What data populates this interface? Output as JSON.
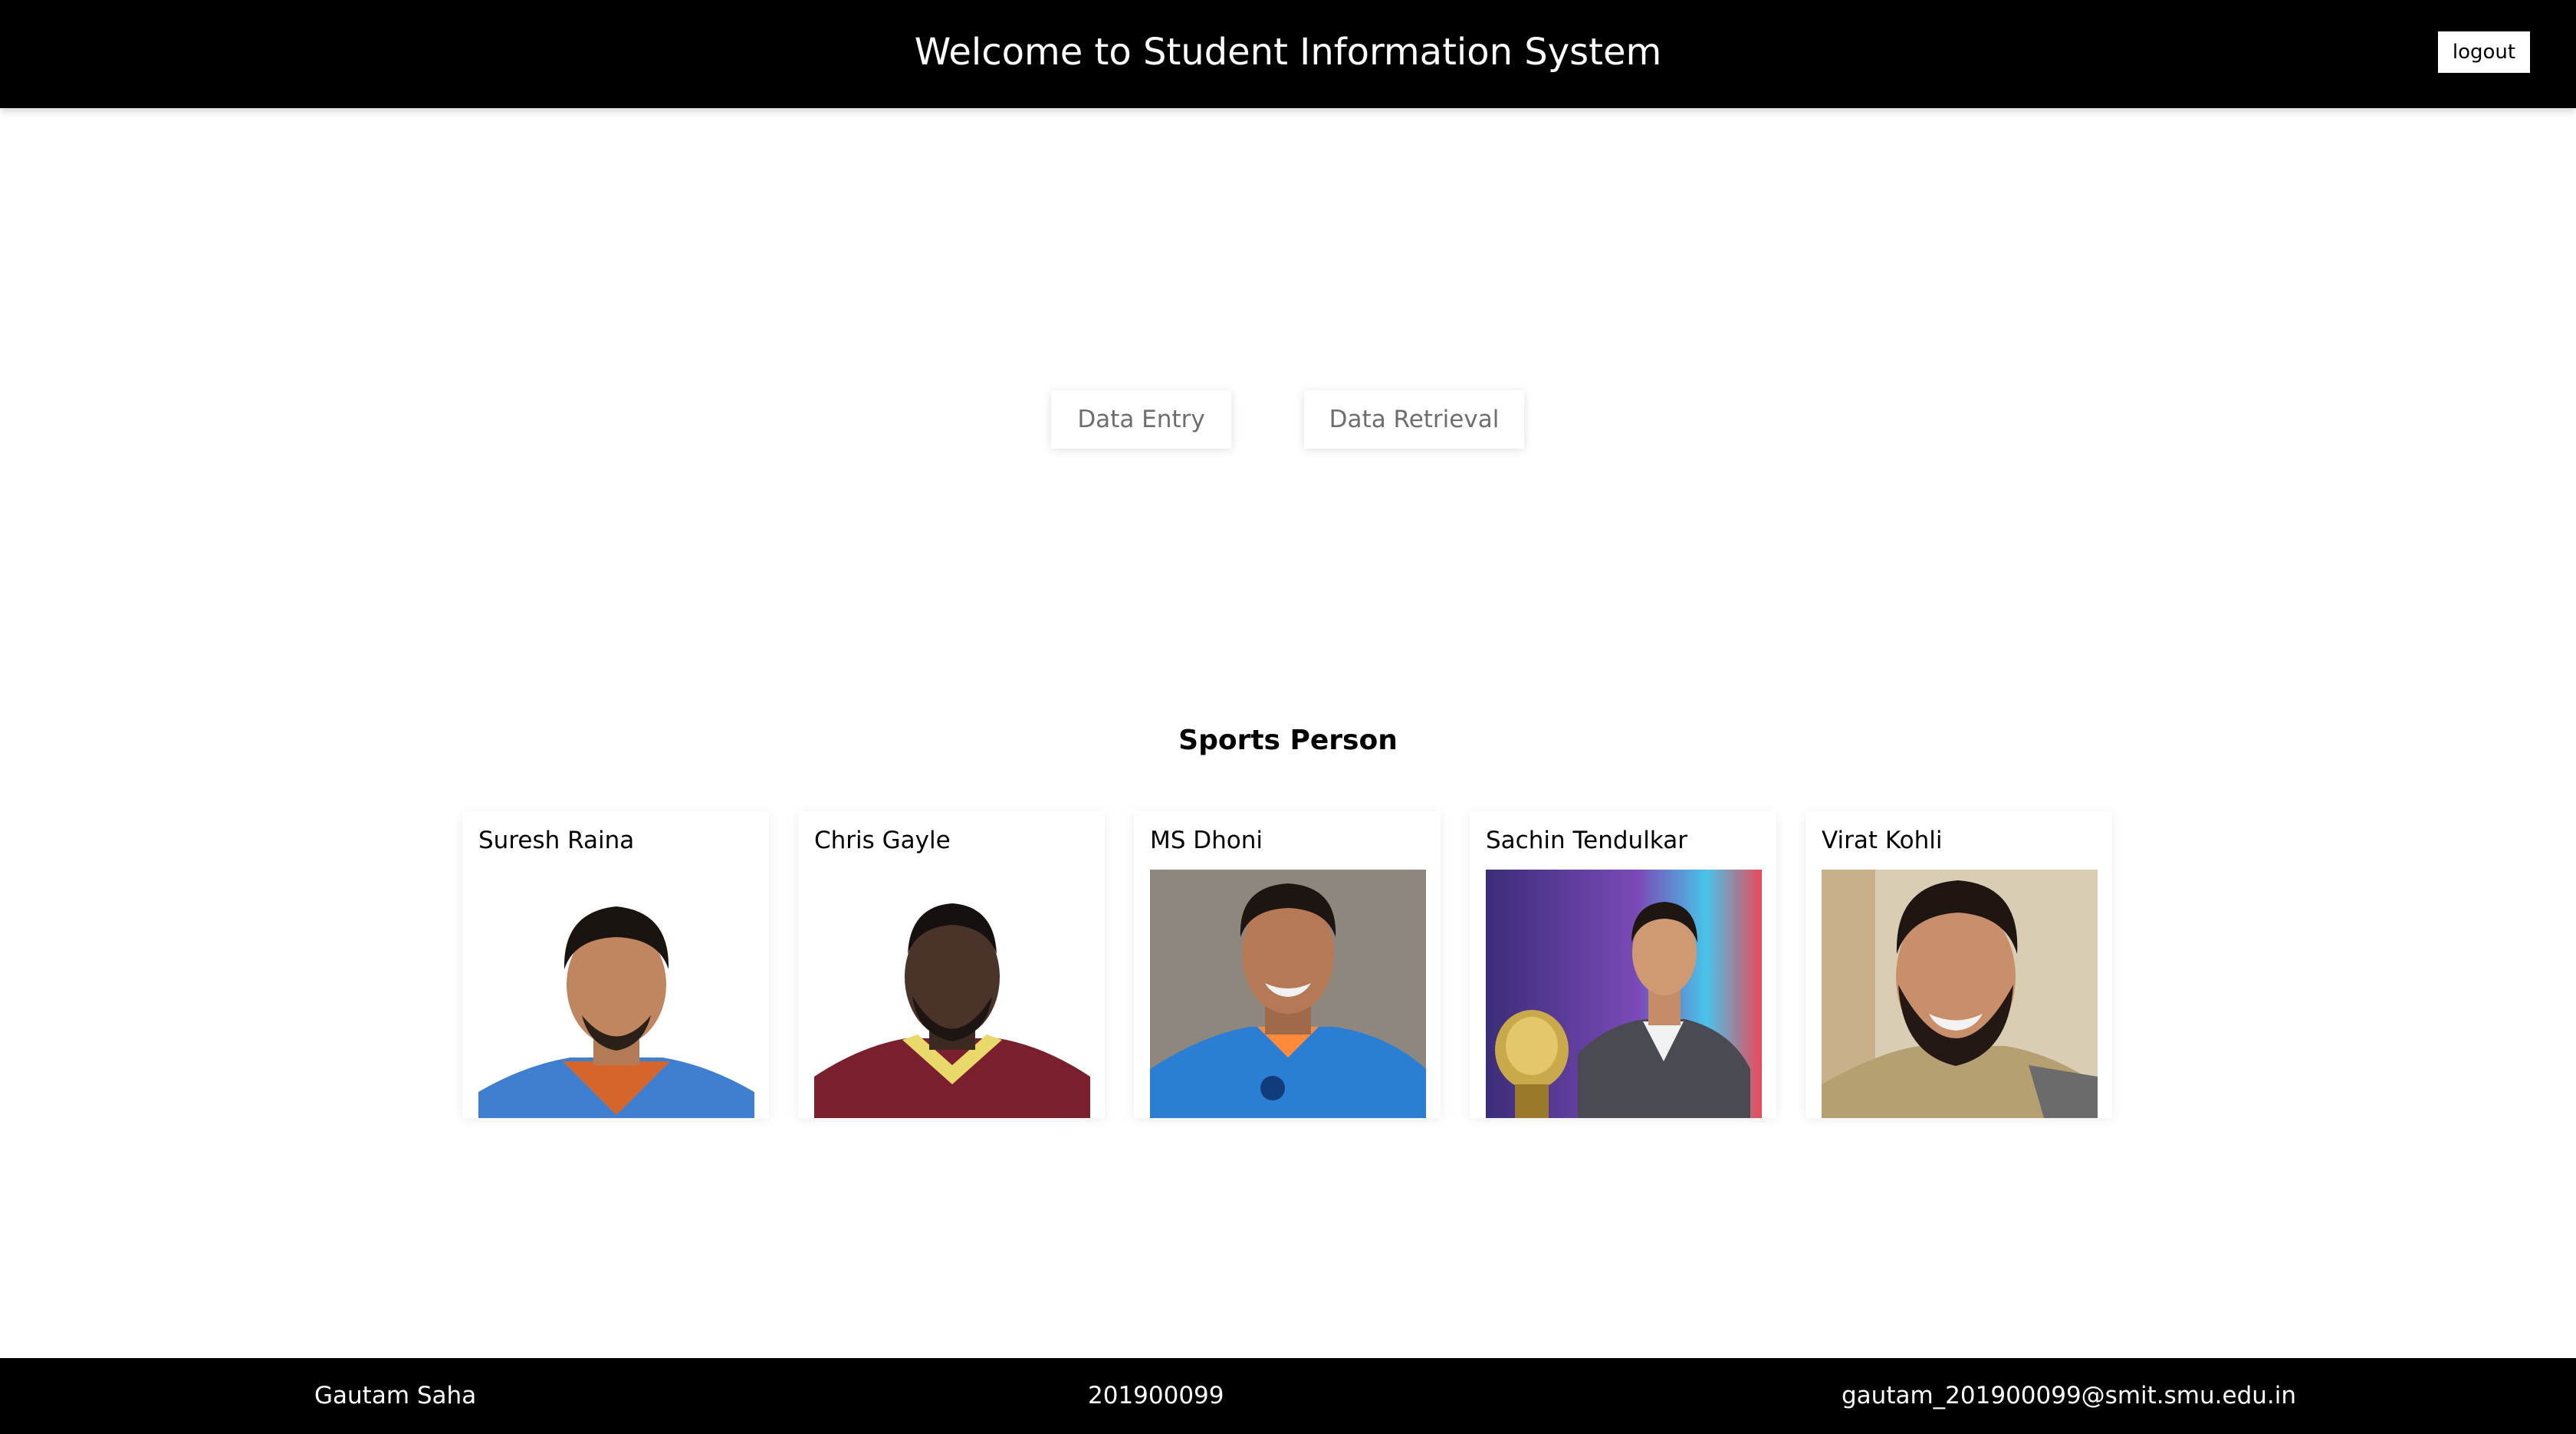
{
  "header": {
    "title": "Welcome to Student Information System",
    "logout_label": "logout"
  },
  "actions": {
    "data_entry_label": "Data Entry",
    "data_retrieval_label": "Data Retrieval"
  },
  "sports": {
    "title": "Sports Person",
    "people": [
      {
        "name": "Suresh Raina"
      },
      {
        "name": "Chris Gayle"
      },
      {
        "name": "MS Dhoni"
      },
      {
        "name": "Sachin Tendulkar"
      },
      {
        "name": "Virat Kohli"
      }
    ]
  },
  "footer": {
    "name": "Gautam Saha",
    "id": "201900099",
    "email": "gautam_201900099@smit.smu.edu.in"
  },
  "colors": {
    "header_bg": "#000000",
    "footer_bg": "#000000",
    "button_text": "#6e6e6e"
  }
}
